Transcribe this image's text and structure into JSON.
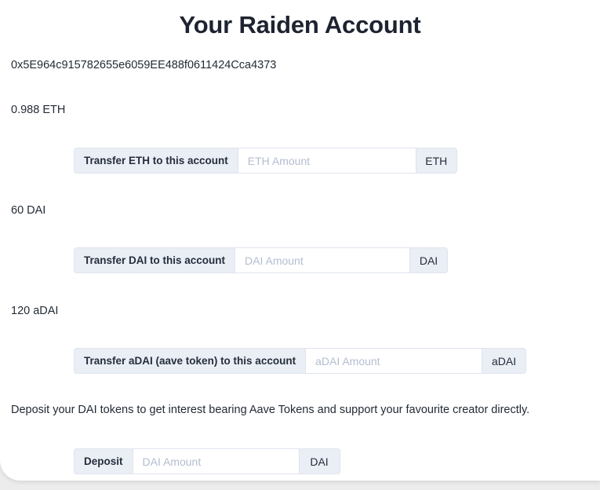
{
  "card": {
    "title": "Your Raiden Account",
    "wallet_address": "0x5E964c915782655e6059EE488f0611424Cca4373"
  },
  "balances": {
    "eth": "0.988 ETH",
    "dai": "60 DAI",
    "adai": "120 aDAI"
  },
  "transfer_eth": {
    "label": "Transfer ETH to this account",
    "placeholder": "ETH Amount",
    "value": "",
    "unit": "ETH"
  },
  "transfer_dai": {
    "label": "Transfer DAI to this account",
    "placeholder": "DAI Amount",
    "value": "",
    "unit": "DAI"
  },
  "transfer_adai": {
    "label": "Transfer aDAI (aave token) to this account",
    "placeholder": "aDAI Amount",
    "value": "",
    "unit": "aDAI"
  },
  "deposit": {
    "description": "Deposit your DAI tokens to get interest bearing Aave Tokens and support your favourite creator directly.",
    "label": "Deposit",
    "placeholder": "DAI Amount",
    "value": "",
    "unit": "DAI"
  },
  "colors": {
    "page_background": "#ececec",
    "card_background": "#ffffff",
    "text": "#232b36",
    "title": "#1d2330",
    "addon_background": "#eaeef5",
    "border": "#dfe4ee",
    "placeholder": "#b3bdd0"
  }
}
